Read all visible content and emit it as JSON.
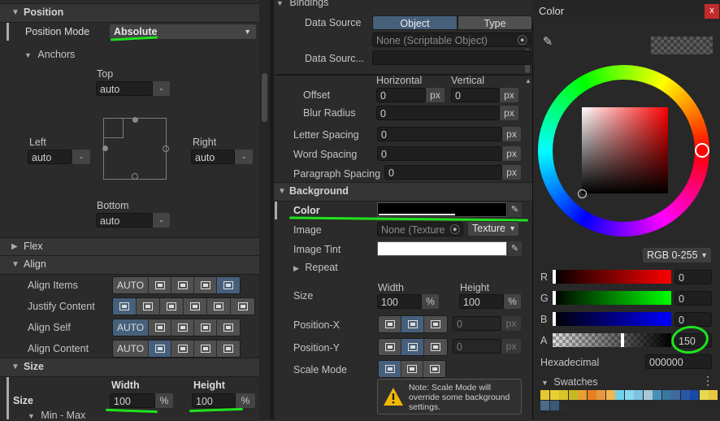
{
  "left": {
    "position_header": "Position",
    "position_mode_label": "Position Mode",
    "position_mode_value": "Absolute",
    "anchors_label": "Anchors",
    "top_label": "Top",
    "top_value": "auto",
    "left_label": "Left",
    "left_value": "auto",
    "right_label": "Right",
    "right_value": "auto",
    "bottom_label": "Bottom",
    "bottom_value": "auto",
    "minus": "-",
    "flex_header": "Flex",
    "align_header": "Align",
    "align_items_label": "Align Items",
    "justify_content_label": "Justify Content",
    "align_self_label": "Align Self",
    "align_content_label": "Align Content",
    "auto_label": "AUTO",
    "size_header": "Size",
    "size_label": "Size",
    "width_label": "Width",
    "width_value": "100",
    "height_label": "Height",
    "height_value": "100",
    "percent_unit": "%",
    "min_max_label": "Min - Max"
  },
  "middle": {
    "bindings_header": "Bindings",
    "data_source_label": "Data Source",
    "tab_object": "Object",
    "tab_type": "Type",
    "object_field_value": "None (Scriptable Object)",
    "data_source_path_label": "Data Sourc...",
    "horizontal_label": "Horizontal",
    "vertical_label": "Vertical",
    "offset_label": "Offset",
    "offset_h": "0",
    "offset_v": "0",
    "blur_label": "Blur Radius",
    "blur_value": "0",
    "letter_spacing_label": "Letter Spacing",
    "letter_spacing_value": "0",
    "word_spacing_label": "Word Spacing",
    "word_spacing_value": "0",
    "paragraph_spacing_label": "Paragraph Spacing",
    "paragraph_spacing_value": "0",
    "px_unit": "px",
    "background_header": "Background",
    "color_label": "Color",
    "image_label": "Image",
    "image_field_value": "None (Texture",
    "texture_dropdown": "Texture",
    "image_tint_label": "Image Tint",
    "repeat_label": "Repeat",
    "size_label": "Size",
    "width_label": "Width",
    "width_value": "100",
    "height_label": "Height",
    "height_value": "100",
    "percent_unit": "%",
    "position_x_label": "Position-X",
    "position_x_value": "0",
    "position_y_label": "Position-Y",
    "position_y_value": "0",
    "scale_mode_label": "Scale Mode",
    "note_text": "Note: Scale Mode will override some background settings."
  },
  "color_picker": {
    "title": "Color",
    "close_glyph": "x",
    "mode_dropdown": "RGB 0-255",
    "r_label": "R",
    "r_value": "0",
    "g_label": "G",
    "g_value": "0",
    "b_label": "B",
    "b_value": "0",
    "a_label": "A",
    "a_value": "150",
    "hex_label": "Hexadecimal",
    "hex_value": "000000",
    "swatches_label": "Swatches",
    "menu_glyph": "⋮",
    "swatches_row1": [
      "#e8c830",
      "#e8d030",
      "#d8c428",
      "#c8b820",
      "#e8a030",
      "#e88020",
      "#e89840",
      "#f0b850",
      "#70d0e8",
      "#88d8f0",
      "#80c0e0",
      "#a8c8d8",
      "#4890b8",
      "#3878a0",
      "#4068a0",
      "#2858a8",
      "#1848a8",
      "#e8d850",
      "#e8c840"
    ],
    "swatches_row2": [
      "#4a6a8a",
      "#3a5a7a",
      "#2a2a2a"
    ]
  }
}
